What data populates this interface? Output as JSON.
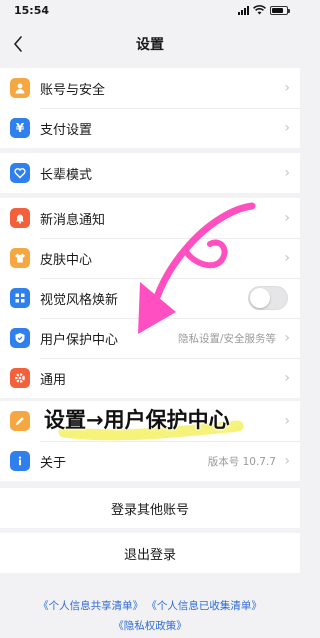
{
  "status_bar": {
    "time": "15:54"
  },
  "nav": {
    "title": "设置"
  },
  "groups": {
    "g1": [
      {
        "label": "账号与安全",
        "icon": "person-icon",
        "color": "#f5a742"
      },
      {
        "label": "支付设置",
        "icon": "yen-icon",
        "color": "#2f80ed"
      }
    ],
    "g2": [
      {
        "label": "长辈模式",
        "icon": "heart-icon",
        "color": "#2f80ed"
      }
    ],
    "g3": [
      {
        "label": "新消息通知",
        "icon": "bell-icon",
        "color": "#f2603c"
      },
      {
        "label": "皮肤中心",
        "icon": "shirt-icon",
        "color": "#f5a742"
      },
      {
        "label": "视觉风格焕新",
        "icon": "grid-icon",
        "color": "#2f80ed",
        "toggle": false
      },
      {
        "label": "用户保护中心",
        "icon": "shield-icon",
        "color": "#2f80ed",
        "value": "隐私设置/安全服务等"
      },
      {
        "label": "通用",
        "icon": "gear-icon",
        "color": "#f2603c"
      }
    ],
    "g4": [
      {
        "label": "",
        "icon": "pencil-icon",
        "color": "#f5a742"
      },
      {
        "label": "关于",
        "icon": "info-icon",
        "color": "#2f80ed",
        "value": "版本号 10.7.7"
      }
    ]
  },
  "buttons": {
    "login_other": "登录其他账号",
    "logout": "退出登录"
  },
  "footer": {
    "link1": "《个人信息共享清单》",
    "link2": "《个人信息已收集清单》",
    "link3": "《隐私权政策》"
  },
  "annotation": {
    "text": "设置→用户保护中心",
    "arrow_color": "#ff4fc0",
    "highlight_color": "#f4f26a"
  }
}
